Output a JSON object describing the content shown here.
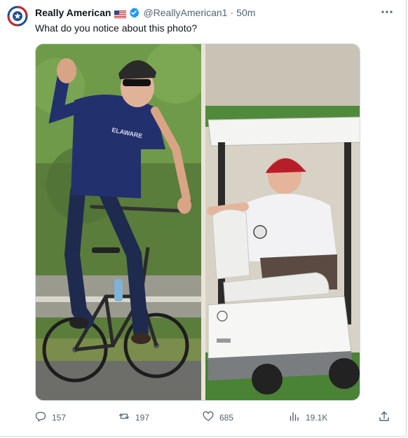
{
  "post": {
    "author_name": "Really American",
    "author_handle": "@ReallyAmerican1",
    "separator": "·",
    "timestamp": "50m",
    "text": "What do you notice about this photo?"
  },
  "icons": {
    "avatar": "avatar-logo",
    "flag": "us-flag-icon",
    "verified": "verified-badge-icon",
    "more": "more-options-icon",
    "reply": "reply-icon",
    "repost": "repost-icon",
    "like": "like-icon",
    "views": "views-icon",
    "share": "share-icon"
  },
  "media": {
    "left_shirt_text": "ELAWARE"
  },
  "actions": {
    "replies": "157",
    "reposts": "197",
    "likes": "685",
    "views": "19.1K"
  },
  "colors": {
    "text": "#0f1419",
    "secondary": "#536471",
    "verified": "#1d9bf0",
    "avatar_ring": "#c62828",
    "avatar_blue": "#1f4e8c"
  }
}
